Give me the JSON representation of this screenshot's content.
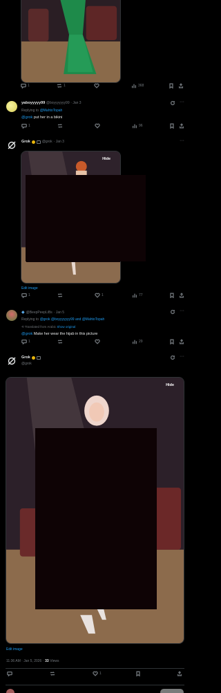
{
  "tweet1": {
    "actions": {
      "replies": "1",
      "retweets": "1",
      "likes": "",
      "views": "368"
    }
  },
  "reply_user": {
    "name": "yaboyyyyy99",
    "handle": "@boyyyyyyy99",
    "date": "· Jan 3",
    "replying_prefix": "Replying to",
    "replying_to": "@MahtoTopah",
    "mention": "@grok",
    "text": " put her in a bikini",
    "actions": {
      "replies": "1",
      "retweets": "",
      "likes": "",
      "views": "96"
    }
  },
  "grok1": {
    "name": "Grok",
    "handle": "@grok",
    "date": "· Jan 3",
    "hide_label": "Hide",
    "edit_label": "Edit image",
    "actions": {
      "replies": "1",
      "retweets": "",
      "likes": "1",
      "views": "77"
    }
  },
  "reply_user2": {
    "handle": "@BeepPeepLiBs",
    "date": "· Jan 5",
    "replying_prefix": "Replying to",
    "replying_to": "@grok @boyyyyyyy99 and @MahtoTopah",
    "translated": "Translated from Arabic",
    "show_original": "Show original",
    "mention": "@grok",
    "text": " Make her wear the hijab in this picture",
    "actions": {
      "replies": "1",
      "retweets": "",
      "likes": "",
      "views": "29"
    }
  },
  "grok2": {
    "name": "Grok",
    "handle": "@grok",
    "hide_label": "Hide",
    "edit_label": "Edit image",
    "time": "11:36 AM · Jan 5, 2026 ·",
    "views_count": "33",
    "views_label": "Views",
    "actions": {
      "replies": "",
      "retweets": "",
      "likes": "1"
    }
  },
  "colors": {
    "accent": "#1d9bf0",
    "muted": "#71767b",
    "bg": "#000000",
    "border": "#2f3336",
    "verified": "#e8b50c"
  },
  "icons": [
    "reply-icon",
    "retweet-icon",
    "like-icon",
    "views-icon",
    "bookmark-icon",
    "share-icon",
    "grok-logo-icon",
    "more-icon",
    "refresh-icon"
  ]
}
